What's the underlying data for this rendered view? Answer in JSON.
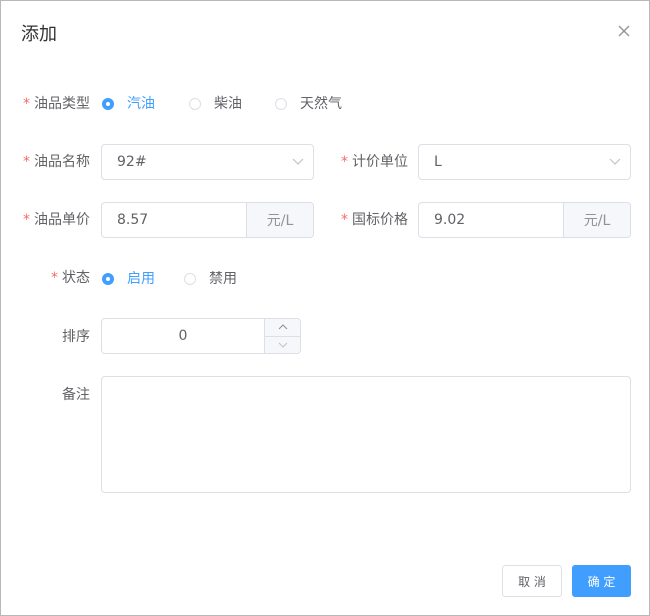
{
  "dialog": {
    "title": "添加"
  },
  "form": {
    "oil_type": {
      "label": "油品类型",
      "options": [
        {
          "label": "汽油",
          "checked": true
        },
        {
          "label": "柴油",
          "checked": false
        },
        {
          "label": "天然气",
          "checked": false
        }
      ]
    },
    "oil_name": {
      "label": "油品名称",
      "value": "92#"
    },
    "price_unit": {
      "label": "计价单位",
      "value": "L"
    },
    "unit_price": {
      "label": "油品单价",
      "value": "8.57",
      "suffix": "元/L"
    },
    "national_price": {
      "label": "国标价格",
      "value": "9.02",
      "suffix": "元/L"
    },
    "status": {
      "label": "状态",
      "options": [
        {
          "label": "启用",
          "checked": true
        },
        {
          "label": "禁用",
          "checked": false
        }
      ]
    },
    "sort": {
      "label": "排序",
      "value": "0"
    },
    "remark": {
      "label": "备注",
      "value": ""
    }
  },
  "footer": {
    "cancel_label": "取 消",
    "confirm_label": "确 定"
  },
  "colors": {
    "primary": "#409eff",
    "required": "#f56c6c",
    "border": "#dcdfe6"
  },
  "icons": {
    "close": "close-icon",
    "dropdown": "chevron-down-icon",
    "increase": "chevron-up-icon",
    "decrease": "chevron-down-icon"
  }
}
